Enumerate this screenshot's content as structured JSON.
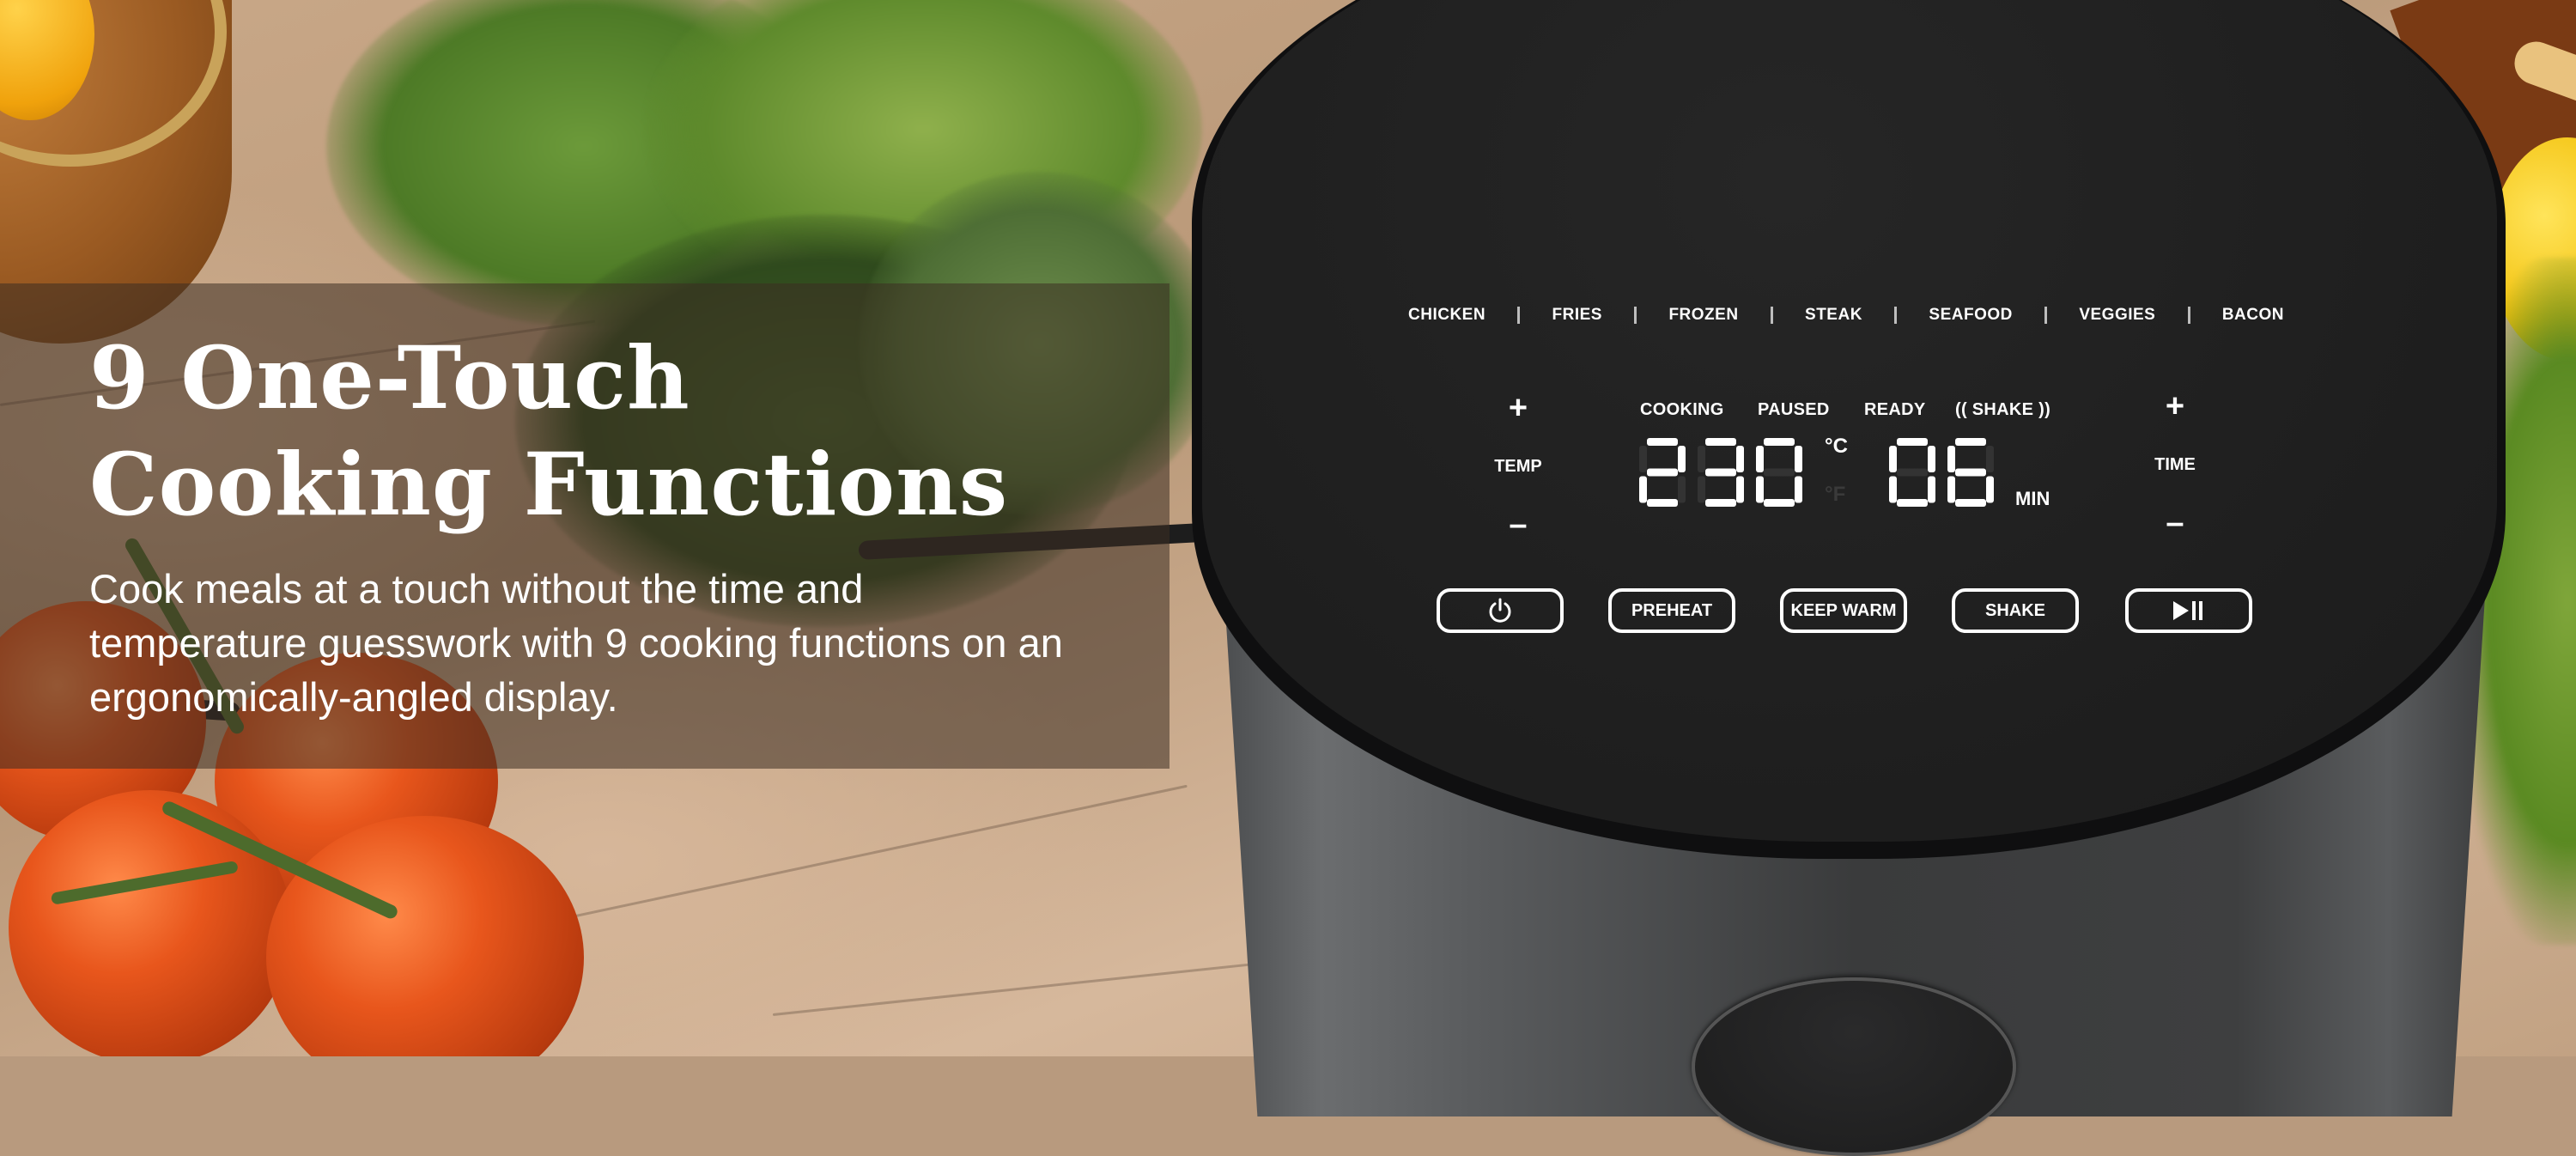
{
  "headline": {
    "line1": "9 One-Touch",
    "line2": "Cooking Functions"
  },
  "description": {
    "line1": "Cook meals at a touch without the time and",
    "line2": "temperature guesswork with 9 cooking functions on an",
    "line3": "ergonomically-angled display."
  },
  "control_panel": {
    "presets": [
      "CHICKEN",
      "FRIES",
      "FROZEN",
      "STEAK",
      "SEAFOOD",
      "VEGGIES",
      "BACON"
    ],
    "temp_control": {
      "plus": "+",
      "label": "TEMP",
      "minus": "–"
    },
    "time_control": {
      "plus": "+",
      "label": "TIME",
      "minus": "–"
    },
    "status_indicators": {
      "cooking": "COOKING",
      "paused": "PAUSED",
      "ready": "READY",
      "shake": "(( SHAKE ))"
    },
    "temperature_value": "230",
    "temperature_unit_active": "°C",
    "temperature_unit_inactive": "°F",
    "time_value": "06",
    "time_unit": "MIN",
    "buttons": {
      "power_icon": "power-icon",
      "preheat": "PREHEAT",
      "keep_warm": "KEEP WARM",
      "shake": "SHAKE",
      "play_pause_icon": "play-pause-icon"
    }
  },
  "colors": {
    "lcd_on": "#ffffff",
    "lcd_off": "#333333",
    "lid": "#1f1f1f",
    "panel_overlay": "#3c2d23"
  }
}
